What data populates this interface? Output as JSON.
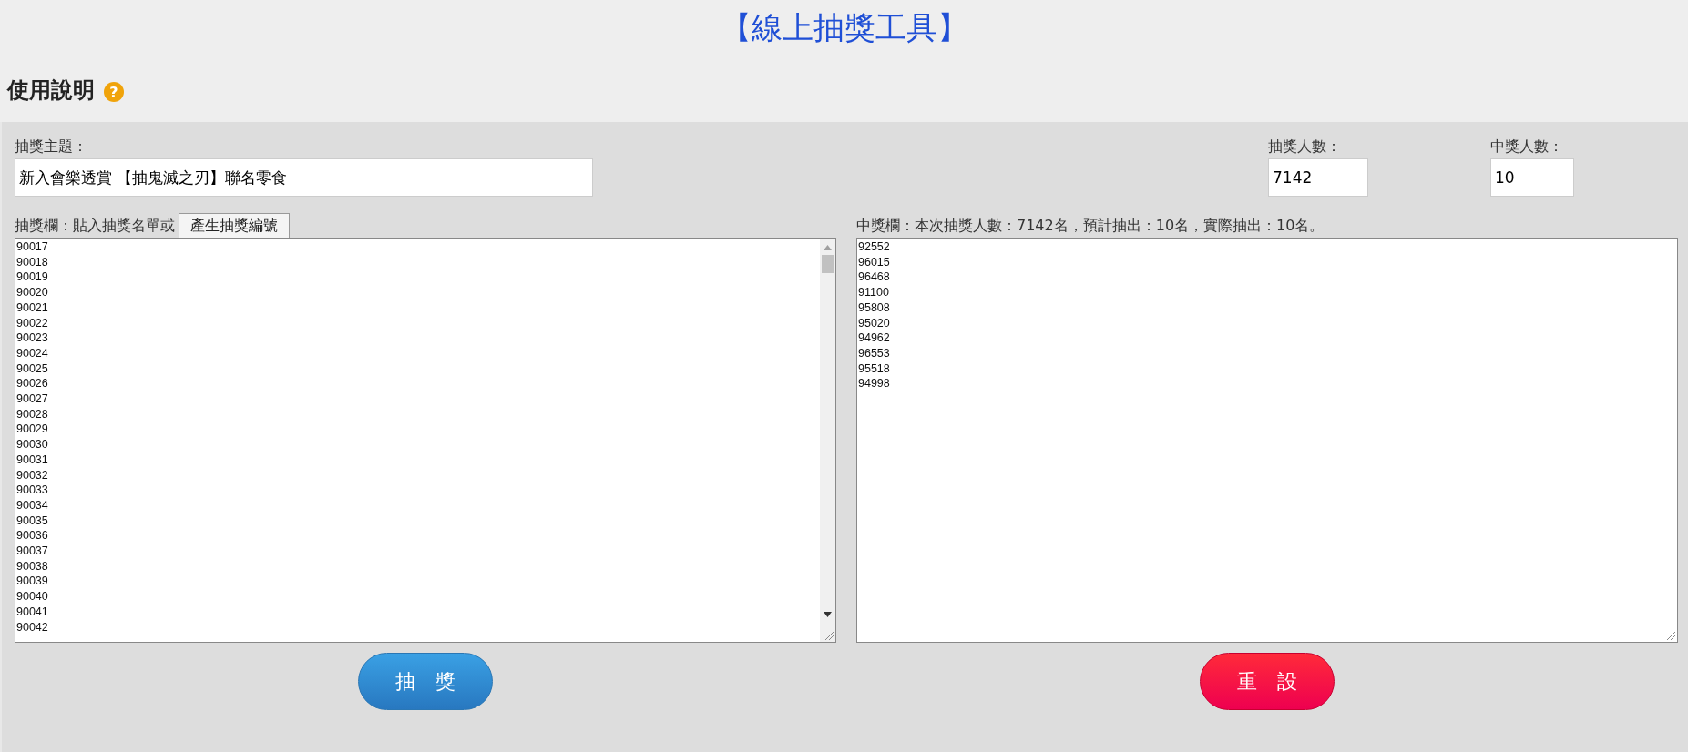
{
  "title": "【線上抽獎工具】",
  "help": {
    "label": "使用說明",
    "icon": "?"
  },
  "topic": {
    "label": "抽獎主題：",
    "value": "新入會樂透賞 【抽鬼滅之刃】聯名零食"
  },
  "participants": {
    "label": "抽獎人數：",
    "value": "7142"
  },
  "winners_count": {
    "label": "中獎人數：",
    "value": "10"
  },
  "entries": {
    "label": "抽獎欄：貼入抽獎名單或",
    "generate_button": "產生抽獎編號",
    "lines": [
      "90017",
      "90018",
      "90019",
      "90020",
      "90021",
      "90022",
      "90023",
      "90024",
      "90025",
      "90026",
      "90027",
      "90028",
      "90029",
      "90030",
      "90031",
      "90032",
      "90033",
      "90034",
      "90035",
      "90036",
      "90037",
      "90038",
      "90039",
      "90040",
      "90041",
      "90042"
    ]
  },
  "results": {
    "label": "中獎欄：本次抽獎人數：7142名，預計抽出：10名，實際抽出：10名。",
    "lines": [
      "92552",
      "96015",
      "96468",
      "91100",
      "95808",
      "95020",
      "94962",
      "96553",
      "95518",
      "94998"
    ]
  },
  "buttons": [
    {
      "kind": "draw",
      "label": "抽　獎"
    },
    {
      "kind": "reset",
      "label": "重　設"
    }
  ]
}
